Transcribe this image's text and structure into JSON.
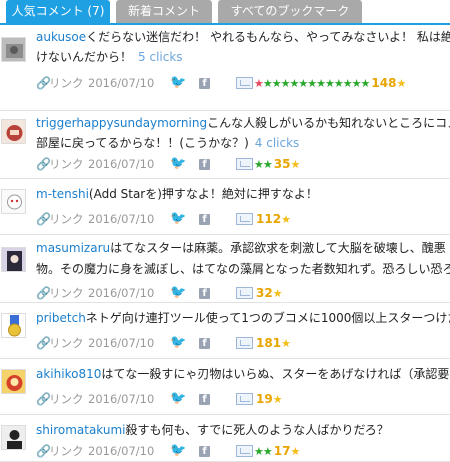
{
  "tabs": [
    {
      "label": "人気コメント (7)",
      "active": true
    },
    {
      "label": "新着コメント",
      "active": false
    },
    {
      "label": "すべてのブックマーク",
      "active": false
    }
  ],
  "common": {
    "link_label": "リンク",
    "twitter_icon": "twitter-icon",
    "facebook_icon": "facebook-icon",
    "facebook_glyph": "f"
  },
  "comments": [
    {
      "user": "aukusoe",
      "text": "くだらない迷信だわ！ やれるもんなら、やってみなさいよ！ 私は絶",
      "text2": "けないんだから！",
      "clicks": "5 clicks",
      "date": "2016/07/10",
      "stars": {
        "red": 1,
        "green": 12,
        "yellow": 1,
        "count": "148"
      },
      "avatar": "photo-gray"
    },
    {
      "user": "triggerhappysundaymorning",
      "text": "こんな人殺しがいるかも知れないところにコメン",
      "text2": "部屋に戻ってるからな！！(こうかな？)",
      "clicks": "4 clicks",
      "date": "2016/07/10",
      "stars": {
        "red": 0,
        "green": 2,
        "yellow": 1,
        "count": "35"
      },
      "avatar": "character-red"
    },
    {
      "user": "m-tenshi",
      "text": "(Add Starを)押すなよ！絶対に押すなよ！",
      "text2": "",
      "clicks": "",
      "date": "2016/07/10",
      "stars": {
        "red": 0,
        "green": 0,
        "yellow": 1,
        "count": "112"
      },
      "avatar": "character-white"
    },
    {
      "user": "masumizaru",
      "text": "はてなスターは麻薬。承認欲求を刺激して大脳を破壊し、醜悪",
      "text2": "物。その魔力に身を滅ぼし、はてなの藻屑となった者数知れず。恐ろしい恐ろ",
      "clicks": "",
      "date": "2016/07/10",
      "stars": {
        "red": 0,
        "green": 0,
        "yellow": 1,
        "count": "32"
      },
      "avatar": "character-dark"
    },
    {
      "user": "pribetch",
      "text": "ネトゲ向け連打ツール使って1つのブコメに1000個以上スターつけた",
      "text2": "",
      "clicks": "",
      "date": "2016/07/10",
      "stars": {
        "red": 0,
        "green": 0,
        "yellow": 1,
        "count": "181"
      },
      "avatar": "medal"
    },
    {
      "user": "akihiko810",
      "text": "はてな一殺すにゃ刃物はいらぬ、スターをあげなければ（承認要",
      "text2": "",
      "clicks": "",
      "date": "2016/07/10",
      "stars": {
        "red": 0,
        "green": 0,
        "yellow": 1,
        "count": "19"
      },
      "avatar": "character-yellow"
    },
    {
      "user": "shiromatakumi",
      "text": "殺すも何も、すでに死人のような人ばかりだろ？",
      "text2": "",
      "clicks": "",
      "date": "2016/07/10",
      "stars": {
        "red": 0,
        "green": 2,
        "yellow": 1,
        "count": "17"
      },
      "avatar": "silhouette"
    }
  ]
}
